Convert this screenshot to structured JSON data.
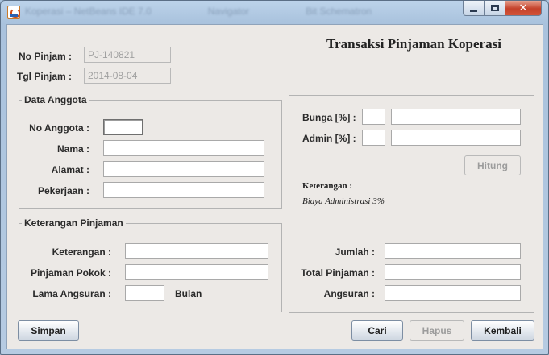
{
  "window": {
    "title_blurred_parts": [
      "Koperasi – NetBeans IDE 7.0",
      "Navigator",
      "Bit Schematron"
    ]
  },
  "header": {
    "title": "Transaksi Pinjaman Koperasi"
  },
  "form": {
    "no_pinjam_label": "No Pinjam :",
    "no_pinjam_value": "PJ-140821",
    "tgl_pinjam_label": "Tgl Pinjam :",
    "tgl_pinjam_value": "2014-08-04"
  },
  "anggota": {
    "group_title": "Data Anggota",
    "no_anggota_label": "No Anggota :",
    "no_anggota_value": "",
    "nama_label": "Nama :",
    "nama_value": "",
    "alamat_label": "Alamat :",
    "alamat_value": "",
    "pekerjaan_label": "Pekerjaan :",
    "pekerjaan_value": ""
  },
  "pinjaman": {
    "group_title": "Keterangan Pinjaman",
    "keterangan_label": "Keterangan :",
    "keterangan_value": "",
    "pokok_label": "Pinjaman Pokok :",
    "pokok_value": "",
    "lama_label": "Lama Angsuran :",
    "lama_value": "",
    "lama_unit": "Bulan"
  },
  "perhitungan": {
    "bunga_label": "Bunga [%] :",
    "bunga_pct": "",
    "bunga_value": "",
    "admin_label": "Admin [%] :",
    "admin_pct": "",
    "admin_value": "",
    "hitung_label": "Hitung",
    "keterangan_heading": "Keterangan :",
    "keterangan_note": "Biaya Administrasi 3%",
    "jumlah_label": "Jumlah :",
    "jumlah_value": "",
    "total_label": "Total Pinjaman :",
    "total_value": "",
    "angsuran_label": "Angsuran :",
    "angsuran_value": ""
  },
  "buttons": {
    "simpan": "Simpan",
    "cari": "Cari",
    "hapus": "Hapus",
    "kembali": "Kembali"
  }
}
